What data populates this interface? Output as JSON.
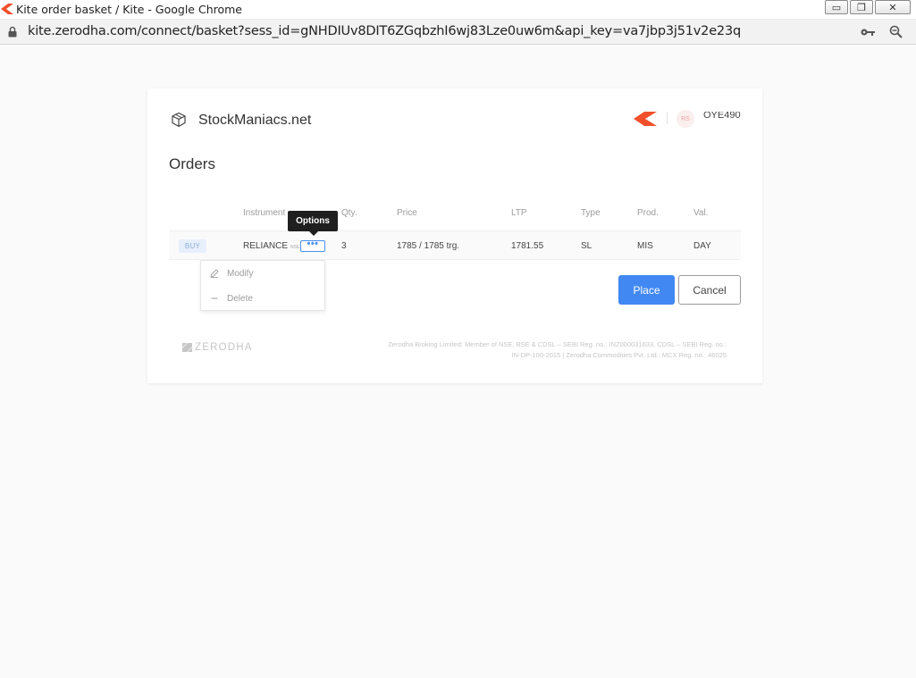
{
  "window": {
    "title": "Kite order basket / Kite - Google Chrome",
    "url": "kite.zerodha.com/connect/basket?sess_id=gNHDIUv8DIT6ZGqbzhI6wj83Lze0uw6m&api_key=va7jbp3j51v2e23q",
    "buttons": {
      "minimize": "▭",
      "restore": "❐",
      "close": "✕"
    }
  },
  "header": {
    "brand": "StockManiacs.net",
    "avatar_initials": "RS",
    "user_id": "OYE490",
    "logo_color": "#f2502b"
  },
  "page": {
    "heading": "Orders"
  },
  "table": {
    "columns": [
      "Instrument",
      "Qty.",
      "Price",
      "LTP",
      "Type",
      "Prod.",
      "Val."
    ],
    "rows": [
      {
        "side": "BUY",
        "instrument": "RELIANCE",
        "exchange": "NSE",
        "options_label": "•••",
        "qty": "3",
        "price": "1785 / 1785 trg.",
        "ltp": "1781.55",
        "type": "SL",
        "product": "MIS",
        "validity": "DAY"
      }
    ]
  },
  "tooltip": {
    "text": "Options"
  },
  "menu": {
    "modify": "Modify",
    "delete": "Delete"
  },
  "actions": {
    "place": "Place",
    "cancel": "Cancel",
    "place_color": "#4188f2"
  },
  "footer": {
    "logo_text": "ZERODHA",
    "line1": "Zerodha Broking Limited: Member of NSE, BSE & CDSL – SEBI Reg. no.: INZ000031633, CDSL – SEBI Reg. no.:",
    "line2": "IN-DP-100-2015 | Zerodha Commodities Pvt. Ltd.: MCX Reg. no.: 46025"
  }
}
